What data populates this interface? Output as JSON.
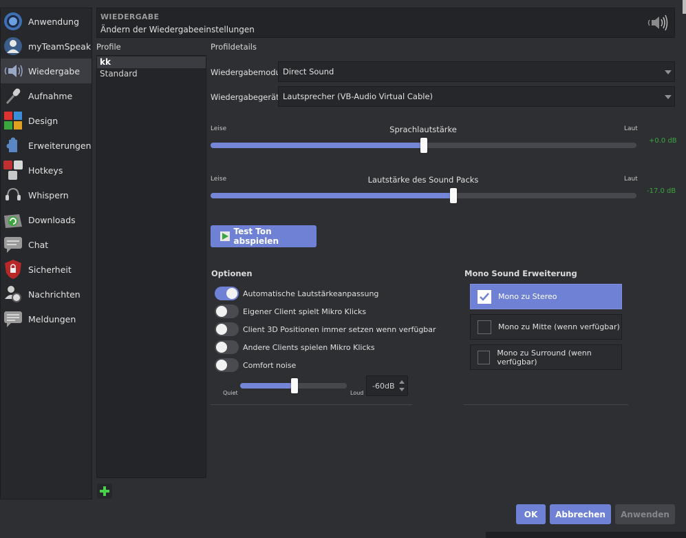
{
  "nav": {
    "items": [
      {
        "label": "Anwendung",
        "icon": "application-icon"
      },
      {
        "label": "myTeamSpeak",
        "icon": "user-icon"
      },
      {
        "label": "Wiedergabe",
        "icon": "speaker-icon"
      },
      {
        "label": "Aufnahme",
        "icon": "microphone-icon"
      },
      {
        "label": "Design",
        "icon": "design-icon"
      },
      {
        "label": "Erweiterungen",
        "icon": "puzzle-icon"
      },
      {
        "label": "Hotkeys",
        "icon": "keys-icon"
      },
      {
        "label": "Whispern",
        "icon": "headset-icon"
      },
      {
        "label": "Downloads",
        "icon": "download-icon"
      },
      {
        "label": "Chat",
        "icon": "chat-icon"
      },
      {
        "label": "Sicherheit",
        "icon": "shield-icon"
      },
      {
        "label": "Nachrichten",
        "icon": "messages-icon"
      },
      {
        "label": "Meldungen",
        "icon": "notifications-icon"
      }
    ],
    "active": "Wiedergabe"
  },
  "header": {
    "title": "WIEDERGABE",
    "subtitle": "Ändern der Wiedergabeeinstellungen",
    "icon": "speaker-waves-icon"
  },
  "profiles": {
    "label": "Profile",
    "items": [
      "kk",
      "Standard"
    ],
    "selected": "kk"
  },
  "details": {
    "label": "Profildetails",
    "mode_label": "Wiedergabemodus:",
    "mode_value": "Direct Sound",
    "device_label": "Wiedergabegerät:",
    "device_value": "Lautsprecher (VB-Audio Virtual Cable)"
  },
  "sliders": {
    "voice": {
      "title": "Sprachlautstärke",
      "left": "Leise",
      "right": "Laut",
      "db": "+0.0 dB",
      "fraction": 0.5
    },
    "soundpack": {
      "title": "Lautstärke des Sound Packs",
      "left": "Leise",
      "right": "Laut",
      "db": "-17.0 dB",
      "fraction": 0.57
    }
  },
  "test_button": "Test Ton abspielen",
  "options": {
    "title": "Optionen",
    "toggles": [
      {
        "label": "Automatische Lautstärkeanpassung",
        "on": true
      },
      {
        "label": "Eigener Client spielt Mikro Klicks",
        "on": false
      },
      {
        "label": "Client 3D Positionen immer setzen wenn verfügbar",
        "on": false
      },
      {
        "label": "Andere Clients spielen Mikro Klicks",
        "on": false
      },
      {
        "label": "Comfort noise",
        "on": false
      }
    ],
    "noise": {
      "quiet": "Quiet",
      "loud": "Loud",
      "value": "-60dB",
      "fraction": 0.51
    }
  },
  "mono": {
    "title": "Mono Sound Erweiterung",
    "items": [
      {
        "label": "Mono zu Stereo",
        "checked": true
      },
      {
        "label": "Mono zu Mitte (wenn verfügbar)",
        "checked": false
      },
      {
        "label": "Mono zu Surround (wenn verfügbar)",
        "checked": false
      }
    ]
  },
  "buttons": {
    "ok": "OK",
    "cancel": "Abbrechen",
    "apply": "Anwenden"
  },
  "colors": {
    "accent": "#6f81d5",
    "db_green": "#3aa63e",
    "background": "#2e2f33"
  }
}
